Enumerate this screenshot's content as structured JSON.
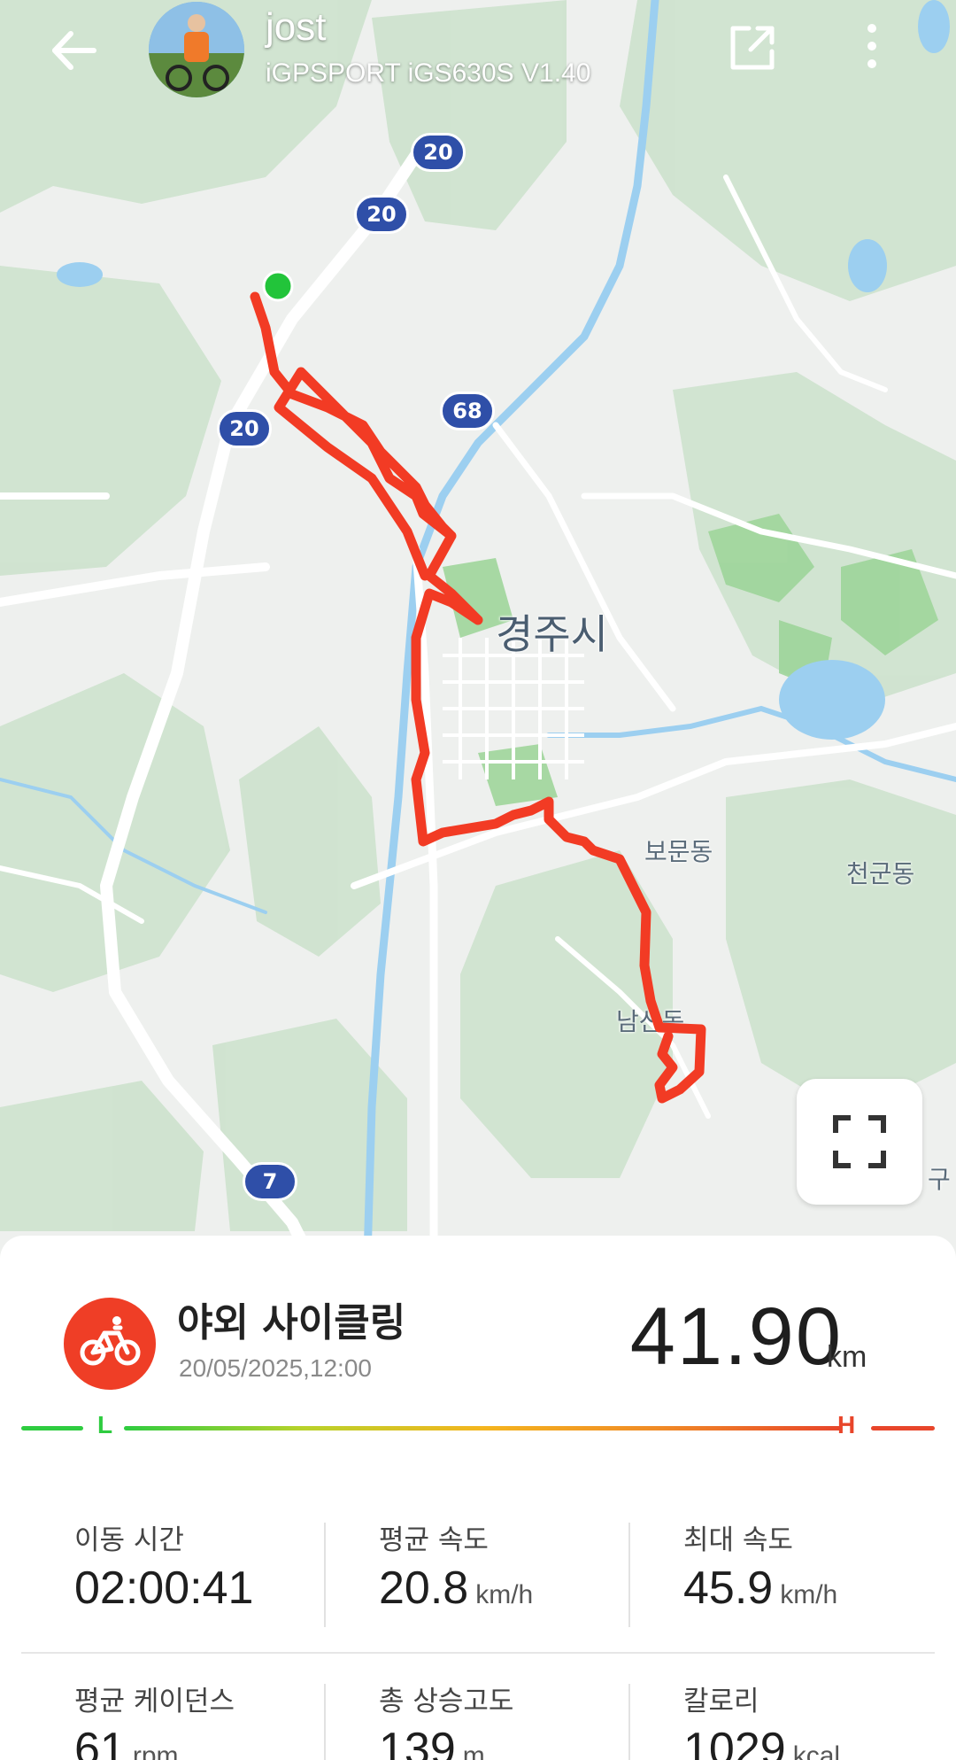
{
  "header": {
    "user_name": "jost",
    "device": "iGPSPORT iGS630S  V1.40",
    "icons": {
      "back": "arrow-left-icon",
      "share": "share-external-icon",
      "more": "more-vertical-icon"
    }
  },
  "map": {
    "city_label": "경주시",
    "place_labels": [
      "보문동",
      "천군동",
      "남산동",
      "구"
    ],
    "road_shields": [
      "20",
      "20",
      "20",
      "68",
      "7"
    ],
    "route_color": "#f23b24",
    "start_marker_color": "#22c43a",
    "fullscreen_icon": "fullscreen-icon"
  },
  "activity": {
    "type_label": "야외 사이클링",
    "datetime": "20/05/2025,12:00",
    "distance": "41.90",
    "distance_unit": "km",
    "sport_icon": "bicycle-icon",
    "accent_color": "#ef3e26"
  },
  "intensity": {
    "low_label": "L",
    "high_label": "H",
    "low_color": "#2ecc40",
    "high_color": "#e8452a"
  },
  "stats": [
    {
      "label": "이동 시간",
      "value": "02:00:41",
      "unit": ""
    },
    {
      "label": "평균 속도",
      "value": "20.8",
      "unit": "km/h"
    },
    {
      "label": "최대 속도",
      "value": "45.9",
      "unit": "km/h"
    },
    {
      "label": "평균 케이던스",
      "value": "61",
      "unit": "rpm"
    },
    {
      "label": "총 상승고도",
      "value": "139",
      "unit": "m"
    },
    {
      "label": "칼로리",
      "value": "1029",
      "unit": "kcal"
    }
  ]
}
